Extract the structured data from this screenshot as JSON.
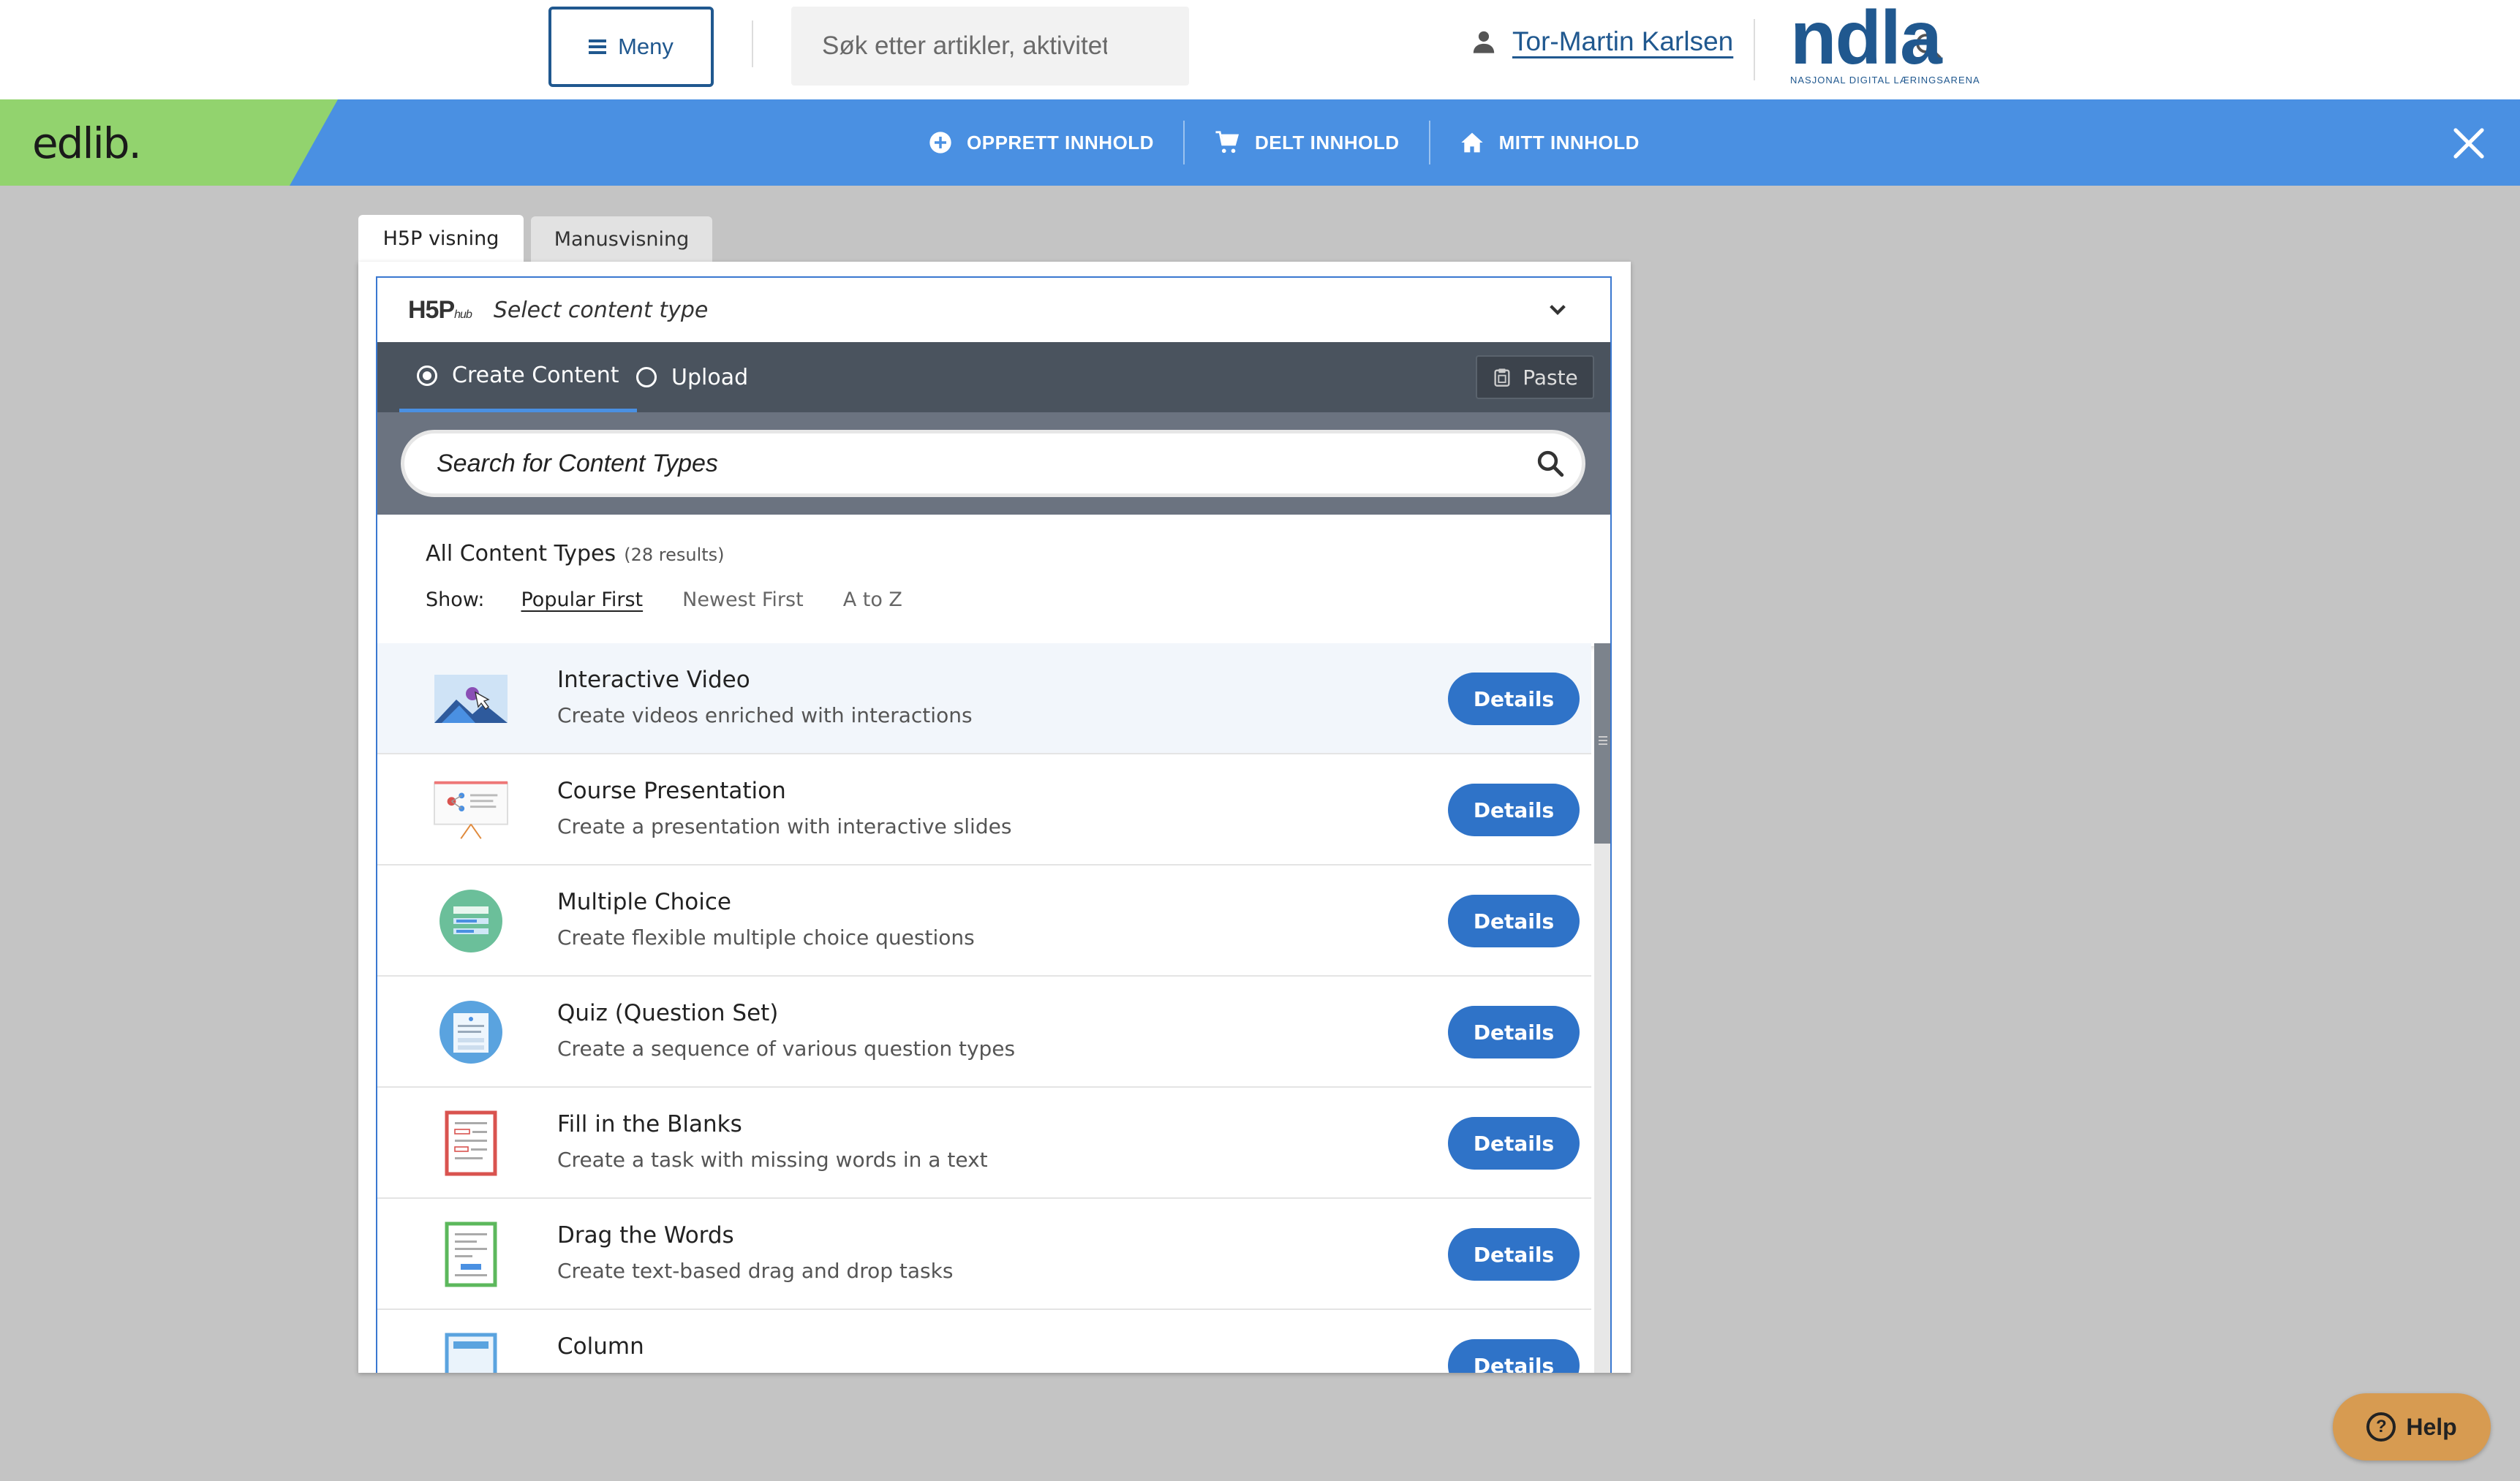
{
  "header": {
    "menu_label": "Meny",
    "search_placeholder": "Søk etter artikler, aktiviteter eller læringsressurser",
    "user_name": "Tor-Martin Karlsen",
    "logo_text": "ndla",
    "logo_subtext": "NASJONAL DIGITAL LÆRINGSARENA"
  },
  "navbar": {
    "brand": "edlib.",
    "items": [
      {
        "label": "OPPRETT INNHOLD",
        "icon": "plus-circle-icon"
      },
      {
        "label": "DELT INNHOLD",
        "icon": "cart-icon"
      },
      {
        "label": "MITT INNHOLD",
        "icon": "home-icon"
      }
    ]
  },
  "view_tabs": [
    {
      "label": "H5P visning",
      "active": true
    },
    {
      "label": "Manusvisning",
      "active": false
    }
  ],
  "hub": {
    "logo": "H5P",
    "logo_suffix": "hub",
    "title": "Select content type",
    "tabs": [
      {
        "label": "Create Content",
        "selected": true
      },
      {
        "label": "Upload",
        "selected": false
      }
    ],
    "paste_label": "Paste",
    "search_placeholder": "Search for Content Types",
    "results_title": "All Content Types",
    "results_count": "(28 results)",
    "show_label": "Show:",
    "sort_options": [
      {
        "label": "Popular First",
        "selected": true
      },
      {
        "label": "Newest First",
        "selected": false
      },
      {
        "label": "A to Z",
        "selected": false
      }
    ],
    "details_label": "Details",
    "items": [
      {
        "title": "Interactive Video",
        "description": "Create videos enriched with interactions",
        "icon": "interactive-video-icon"
      },
      {
        "title": "Course Presentation",
        "description": "Create a presentation with interactive slides",
        "icon": "course-presentation-icon"
      },
      {
        "title": "Multiple Choice",
        "description": "Create flexible multiple choice questions",
        "icon": "multiple-choice-icon"
      },
      {
        "title": "Quiz (Question Set)",
        "description": "Create a sequence of various question types",
        "icon": "question-set-icon"
      },
      {
        "title": "Fill in the Blanks",
        "description": "Create a task with missing words in a text",
        "icon": "fill-in-blanks-icon"
      },
      {
        "title": "Drag the Words",
        "description": "Create text-based drag and drop tasks",
        "icon": "drag-the-words-icon"
      },
      {
        "title": "Column",
        "description": "",
        "icon": "column-icon"
      }
    ]
  },
  "help_label": "Help",
  "colors": {
    "brand_blue": "#4a90e2",
    "edlib_green": "#92d36e",
    "ndla_blue": "#20588f",
    "details_blue": "#2f73c8",
    "help_orange": "#d79b51"
  }
}
